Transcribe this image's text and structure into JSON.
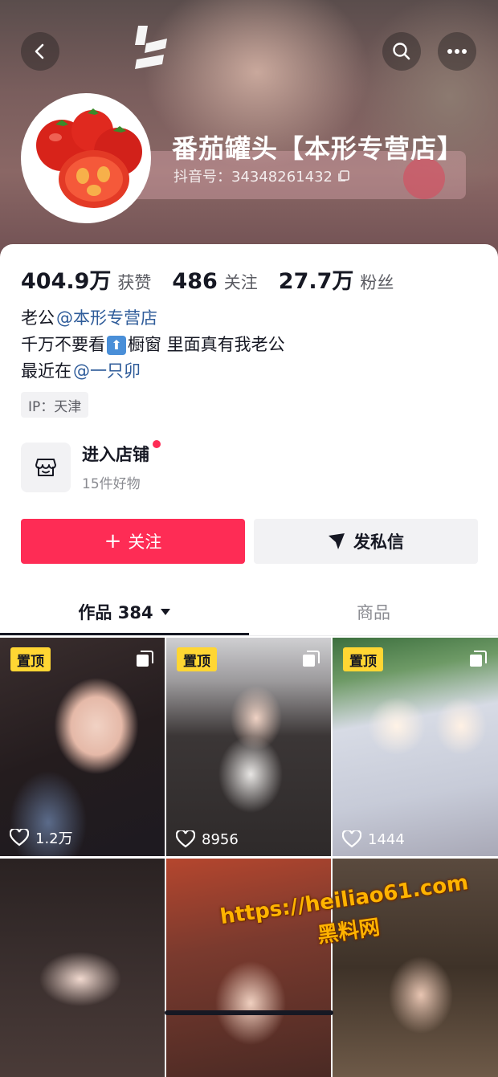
{
  "header": {
    "back_icon": "back-arrow-icon",
    "search_icon": "search-icon",
    "more_icon": "more-dots-icon"
  },
  "profile": {
    "name": "番茄罐头【本形专营店】",
    "douyin_id": "抖音号：34348261432",
    "copy_icon": "copy-icon"
  },
  "stats": [
    {
      "value": "404.9万",
      "label": "获赞"
    },
    {
      "value": "486",
      "label": "关注"
    },
    {
      "value": "27.7万",
      "label": "粉丝"
    }
  ],
  "bio": {
    "line1_prefix": "老公",
    "line1_mention": "@本形专营店",
    "line2_before": "千万不要看",
    "line2_emoji": "⬆",
    "line2_after": "橱窗 里面真有我老公",
    "line3_prefix": "最近在",
    "line3_mention": "@一只卯"
  },
  "ip": "IP：天津",
  "shop": {
    "title": "进入店铺",
    "subtitle": "15件好物"
  },
  "buttons": {
    "follow_plus": "+",
    "follow": "关注",
    "dm": "发私信"
  },
  "tabs": {
    "works": "作品 384",
    "goods": "商品"
  },
  "videos": [
    {
      "pinned": "置顶",
      "likes": "1.2万"
    },
    {
      "pinned": "置顶",
      "likes": "8956"
    },
    {
      "pinned": "置顶",
      "likes": "1444"
    },
    {
      "pinned": "",
      "likes": ""
    },
    {
      "pinned": "",
      "likes": ""
    },
    {
      "pinned": "",
      "likes": ""
    }
  ],
  "watermark": {
    "url": "https://heiliao61.com",
    "name": "黑料网"
  },
  "colors": {
    "accent": "#fe2c55",
    "mention": "#2f5c9a",
    "pin_badge": "#ffd633"
  }
}
